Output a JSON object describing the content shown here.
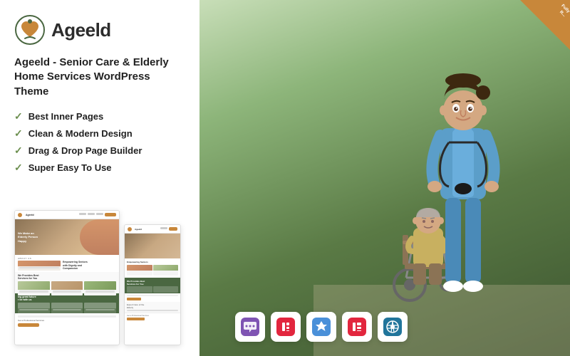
{
  "logo": {
    "text": "Ageeld",
    "icon_alt": "heart with hands logo"
  },
  "product": {
    "title": "Ageeld - Senior Care & Elderly Home Services WordPress Theme",
    "features": [
      "Best Inner Pages",
      "Clean & Modern Design",
      "Drag & Drop Page Builder",
      "Super Easy To Use"
    ]
  },
  "badge": {
    "line1": "Fully",
    "line2": "R..."
  },
  "plugins": [
    {
      "name": "WooCommerce",
      "icon": "🛒"
    },
    {
      "name": "Elementor",
      "icon": "⚡"
    },
    {
      "name": "WordPress",
      "icon": "Ⓦ"
    }
  ],
  "screenshot": {
    "hero_text": "We Make an\nElderly Person\nHappy",
    "section1_title": "Empowering Seniors\nwith Dignity and\nCompassion",
    "section2_title": "We Provides Best\nServices for You",
    "cta_text": "Get a Professional Services"
  },
  "colors": {
    "orange": "#c8873a",
    "green_dark": "#4a6741",
    "green_medium": "#6b8e4e",
    "text_dark": "#222222",
    "white": "#ffffff"
  }
}
